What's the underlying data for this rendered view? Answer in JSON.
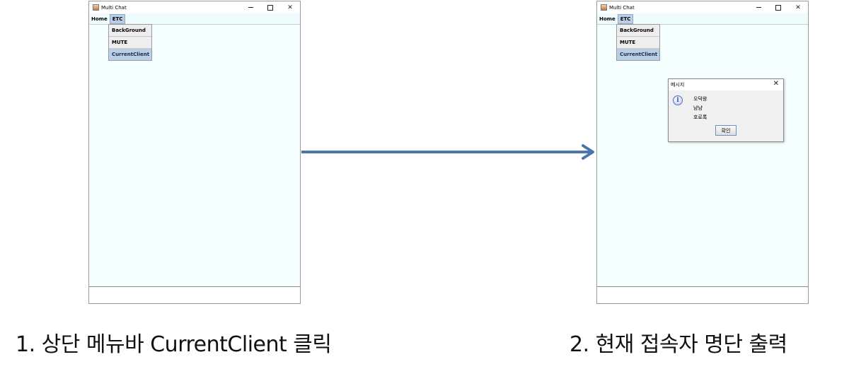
{
  "window_title": "Multi Chat",
  "title_controls": {
    "close": "✕"
  },
  "menubar": {
    "home": "Home",
    "etc": "ETC"
  },
  "dropdown_items": [
    "BackGround",
    "MUTE",
    "CurrentClient"
  ],
  "dialog": {
    "title": "메시지",
    "close": "✕",
    "icon_glyph": "i",
    "lines": [
      "오덕왕",
      "냠냠",
      "호로록"
    ],
    "ok_label": "확인"
  },
  "captions": {
    "step1": "1. 상단 메뉴바 CurrentClient 클릭",
    "step2": "2. 현재 접속자 명단 출력"
  },
  "colors": {
    "arrow": "#4a76ad",
    "chat_bg": "#f5ffff",
    "menubar_bg": "#eefcfd",
    "menu_highlight": "#b8cfe5"
  }
}
